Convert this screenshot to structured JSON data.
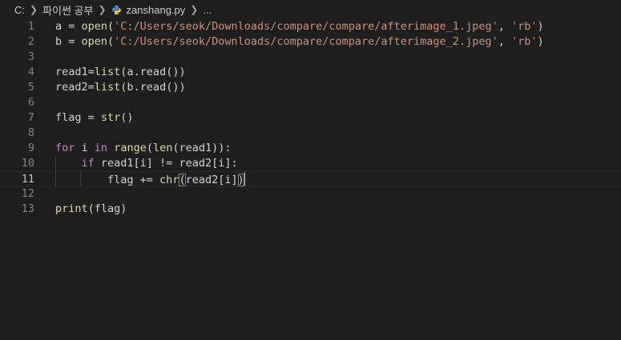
{
  "breadcrumb": {
    "drive": "C:",
    "folder": "파이썬 공부",
    "file": "zanshang.py",
    "more": "..."
  },
  "editor": {
    "lines": [
      {
        "num": "1",
        "tokens": [
          {
            "t": "a = ",
            "c": "var"
          },
          {
            "t": "open",
            "c": "fn"
          },
          {
            "t": "(",
            "c": "var"
          },
          {
            "t": "'C:/Users/seok/Downloads/compare/compare/afterimage_1.jpeg'",
            "c": "str"
          },
          {
            "t": ", ",
            "c": "var"
          },
          {
            "t": "'rb'",
            "c": "str"
          },
          {
            "t": ")",
            "c": "var"
          }
        ]
      },
      {
        "num": "2",
        "tokens": [
          {
            "t": "b = ",
            "c": "var"
          },
          {
            "t": "open",
            "c": "fn"
          },
          {
            "t": "(",
            "c": "var"
          },
          {
            "t": "'C:/Users/seok/Downloads/compare/compare/afterimage_2.jpeg'",
            "c": "str"
          },
          {
            "t": ", ",
            "c": "var"
          },
          {
            "t": "'rb'",
            "c": "str"
          },
          {
            "t": ")",
            "c": "var"
          }
        ]
      },
      {
        "num": "3",
        "tokens": []
      },
      {
        "num": "4",
        "tokens": [
          {
            "t": "read1=",
            "c": "var"
          },
          {
            "t": "list",
            "c": "fn"
          },
          {
            "t": "(a.read())",
            "c": "var"
          }
        ]
      },
      {
        "num": "5",
        "tokens": [
          {
            "t": "read2=",
            "c": "var"
          },
          {
            "t": "list",
            "c": "fn"
          },
          {
            "t": "(b.read())",
            "c": "var"
          }
        ]
      },
      {
        "num": "6",
        "tokens": []
      },
      {
        "num": "7",
        "tokens": [
          {
            "t": "flag = ",
            "c": "var"
          },
          {
            "t": "str",
            "c": "fn"
          },
          {
            "t": "()",
            "c": "var"
          }
        ]
      },
      {
        "num": "8",
        "tokens": []
      },
      {
        "num": "9",
        "tokens": [
          {
            "t": "for",
            "c": "kw"
          },
          {
            "t": " i ",
            "c": "var"
          },
          {
            "t": "in",
            "c": "kw"
          },
          {
            "t": " ",
            "c": "var"
          },
          {
            "t": "range",
            "c": "fn"
          },
          {
            "t": "(",
            "c": "var"
          },
          {
            "t": "len",
            "c": "fn"
          },
          {
            "t": "(read1)):",
            "c": "var"
          }
        ]
      },
      {
        "num": "10",
        "tokens": [
          {
            "t": "    ",
            "c": "var"
          },
          {
            "t": "if",
            "c": "kw"
          },
          {
            "t": " read1[i] != read2[i]:",
            "c": "var"
          }
        ]
      },
      {
        "num": "11",
        "tokens": [
          {
            "t": "        flag += ",
            "c": "var"
          },
          {
            "t": "chr",
            "c": "fn"
          },
          {
            "t": "(",
            "c": "var",
            "m": true
          },
          {
            "t": "read2[i]",
            "c": "var"
          },
          {
            "t": ")",
            "c": "var",
            "m": true
          }
        ],
        "cursor": true
      },
      {
        "num": "12",
        "tokens": []
      },
      {
        "num": "13",
        "tokens": [
          {
            "t": "print",
            "c": "fn"
          },
          {
            "t": "(flag)",
            "c": "var"
          }
        ]
      }
    ],
    "active_line": "11"
  },
  "colors": {
    "background": "#1e1e1e",
    "keyword": "#c586c0",
    "function": "#dcdcaa",
    "string": "#ce9178",
    "text": "#d4d4d4",
    "line_number": "#858585"
  }
}
